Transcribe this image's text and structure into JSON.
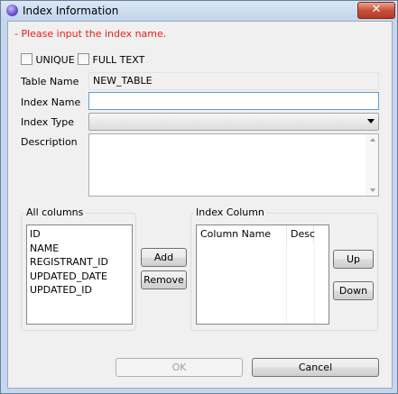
{
  "window": {
    "title": "Index Information",
    "close_glyph": "✕"
  },
  "message": "- Please input the index name.",
  "options": {
    "unique_label": "UNIQUE",
    "fulltext_label": "FULL TEXT"
  },
  "form": {
    "table_name_label": "Table Name",
    "table_name_value": "NEW_TABLE",
    "index_name_label": "Index Name",
    "index_name_value": "",
    "index_type_label": "Index Type",
    "index_type_value": "",
    "description_label": "Description",
    "description_value": ""
  },
  "all_columns": {
    "label": "All columns",
    "items": [
      "ID",
      "NAME",
      "REGISTRANT_ID",
      "UPDATED_DATE",
      "UPDATED_ID"
    ]
  },
  "buttons": {
    "add": "Add",
    "remove": "Remove",
    "up": "Up",
    "down": "Down",
    "ok": "OK",
    "cancel": "Cancel"
  },
  "index_column": {
    "label": "Index Column",
    "headers": [
      "Column Name",
      "Desc"
    ]
  }
}
